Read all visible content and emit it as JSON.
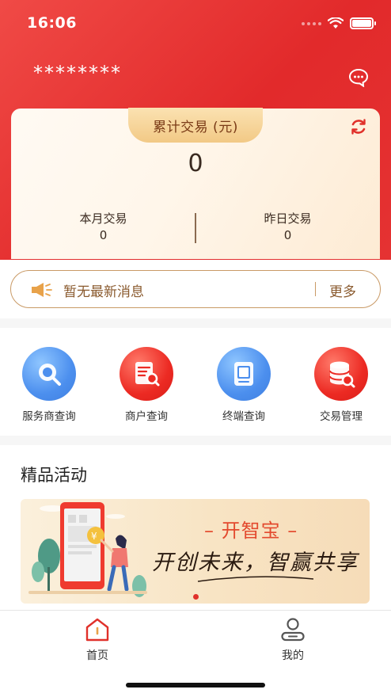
{
  "status_bar": {
    "time": "16:06"
  },
  "header": {
    "account_name": "********"
  },
  "summary": {
    "total_label": "累计交易 (元)",
    "total_value": "0",
    "month_label": "本月交易",
    "month_value": "0",
    "yesterday_label": "昨日交易",
    "yesterday_value": "0"
  },
  "notice": {
    "text": "暂无最新消息",
    "more_label": "更多"
  },
  "menu": {
    "items": [
      {
        "label": "服务商查询",
        "icon": "search-icon",
        "color": "#4c8fee"
      },
      {
        "label": "商户查询",
        "icon": "document-search-icon",
        "color": "#ec2a23"
      },
      {
        "label": "终端查询",
        "icon": "terminal-icon",
        "color": "#4c8fee"
      },
      {
        "label": "交易管理",
        "icon": "database-search-icon",
        "color": "#ec2a23"
      }
    ]
  },
  "activities": {
    "title": "精品活动",
    "banner": {
      "title": "– 开智宝 –",
      "slogan": "开创未来，智赢共享"
    }
  },
  "tabbar": {
    "items": [
      {
        "label": "首页"
      },
      {
        "label": "我的"
      }
    ]
  },
  "colors": {
    "brand_red": "#e22a2b",
    "accent_gold": "#c99a66"
  }
}
